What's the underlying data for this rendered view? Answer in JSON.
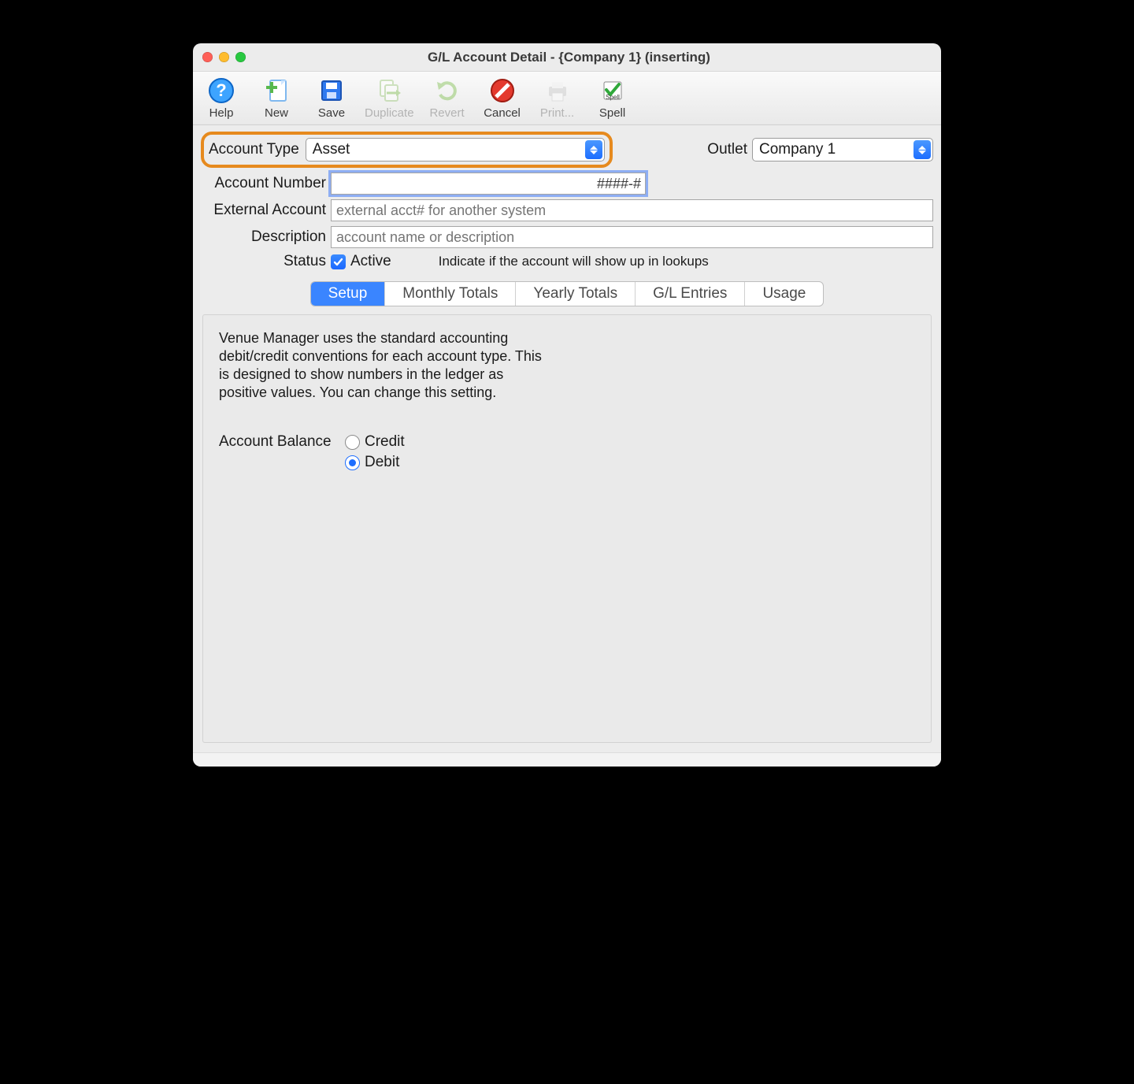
{
  "window": {
    "title": "G/L Account Detail -  {Company 1} (inserting)"
  },
  "toolbar": {
    "help": "Help",
    "new": "New",
    "save": "Save",
    "duplicate": "Duplicate",
    "revert": "Revert",
    "cancel": "Cancel",
    "print": "Print...",
    "spell": "Spell"
  },
  "form": {
    "accountTypeLabel": "Account Type",
    "accountTypeValue": "Asset",
    "outletLabel": "Outlet",
    "outletValue": "Company 1",
    "accountNumberLabel": "Account Number",
    "accountNumberValue": "",
    "accountNumberMask": "####-#",
    "externalAccountLabel": "External Account",
    "externalAccountPlaceholder": "external acct# for another system",
    "descriptionLabel": "Description",
    "descriptionPlaceholder": "account name or description",
    "statusLabel": "Status",
    "statusCheckboxLabel": "Active",
    "statusChecked": true,
    "statusHint": "Indicate if the account will show up in lookups"
  },
  "tabs": {
    "setup": "Setup",
    "monthly": "Monthly Totals",
    "yearly": "Yearly Totals",
    "gl": "G/L Entries",
    "usage": "Usage",
    "active": "setup"
  },
  "setupPanel": {
    "help": "Venue Manager uses the standard accounting debit/credit conventions for each account type. This is designed to show numbers in the ledger as positive values.   You can change this setting.",
    "accountBalanceLabel": "Account Balance",
    "creditLabel": "Credit",
    "debitLabel": "Debit",
    "selected": "debit"
  }
}
